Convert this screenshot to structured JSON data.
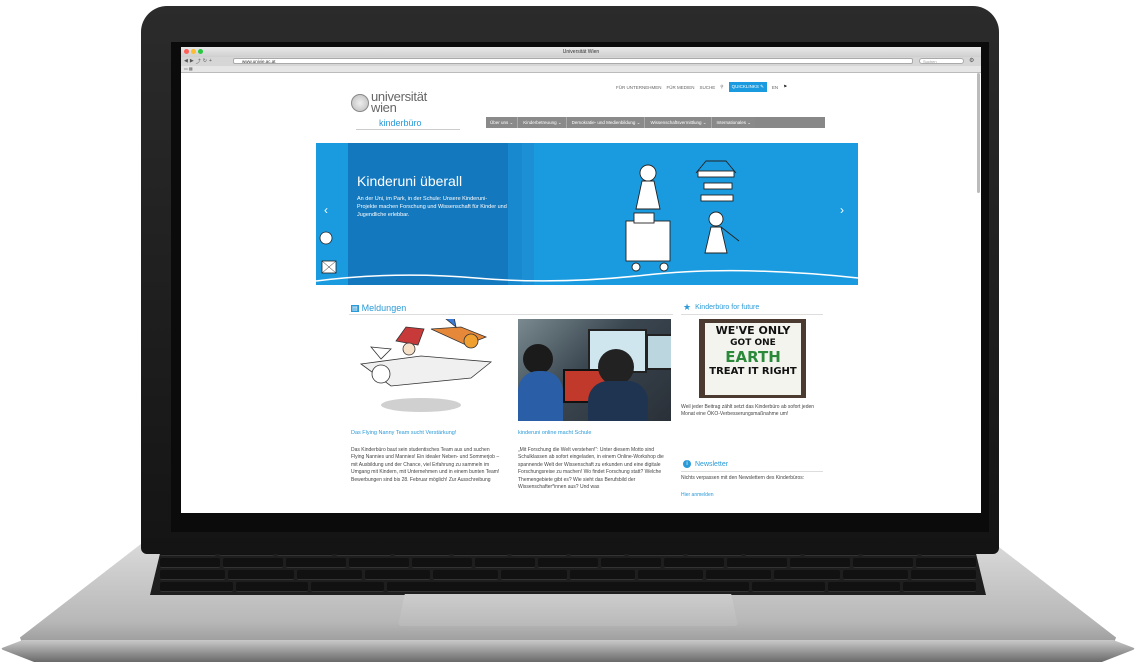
{
  "browser": {
    "window_title": "Universität Wien",
    "url": "www.univie.ac.at",
    "search_placeholder": "Suchen"
  },
  "topnav": {
    "items": [
      "FÜR UNTERNEHMEN",
      "FÜR MEDIEN",
      "SUCHE"
    ],
    "quicklinks": "QUICKLINKS",
    "lang": "EN"
  },
  "logo": {
    "line1": "universität",
    "line2": "wien",
    "sub": "kinderbüro"
  },
  "menu": {
    "items": [
      "Über uns",
      "Kinderbetreuung",
      "Demokratie- und Medienbildung",
      "Wissenschaftsvermittlung",
      "Internationales"
    ]
  },
  "hero": {
    "title": "Kinderuni überall",
    "text": "An der Uni, im Park, in der Schule: Unsere Kinderuni-Projekte machen Forschung und Wissenschaft für Kinder und Jugendliche erlebbar."
  },
  "news": {
    "heading": "Meldungen",
    "items": [
      {
        "title": "Das Flying Nanny Team sucht Verstärkung!",
        "text": "Das Kinderbüro baut sein studentisches Team aus und suchen Flying Nannies und Mannies! Ein idealer Neben- und Sommerjob – mit Ausbildung und der Chance, viel Erfahrung zu sammeln im Umgang mit Kindern, mit Unternehmen und in einem bunten Team! Bewerbungen sind bis 28. Februar möglich! Zur Ausschreibung"
      },
      {
        "title": "kinderuni online macht Schule",
        "text": "„Mit Forschung die Welt verstehen!“: Unter diesem Motto sind Schulklassen ab sofort eingeladen, in einem Online-Workshop die spannende Welt der Wissenschaft zu erkunden und eine digitale Forschungsreise zu machen! Wo findet Forschung statt? Welche Themengebiete gibt es? Wie sieht das Berufsbild der Wissenschafter*innen aus? Und was"
      }
    ]
  },
  "sidebar": {
    "future_heading": "Kinderbüro for future",
    "poster_lines": [
      "WE'VE ONLY",
      "GOT ONE",
      "EARTH",
      "TREAT IT RIGHT"
    ],
    "future_text": "Weil jeder Beitrag zählt setzt das Kinderbüro ab sofort jeden Monat eine ÖKO-Verbesserungsmaßnahme um!",
    "newsletter_heading": "Newsletter",
    "newsletter_text": "Nichts verpassen mit den Newslettern des Kinderbüros:",
    "newsletter_link": "Hier anmelden"
  },
  "colors": {
    "accent": "#2a9ad8",
    "hero_bg": "#1a9be0",
    "hero_panel": "#1478be",
    "quicklinks_bg": "#1a9be0",
    "menu_bg": "#888888"
  }
}
